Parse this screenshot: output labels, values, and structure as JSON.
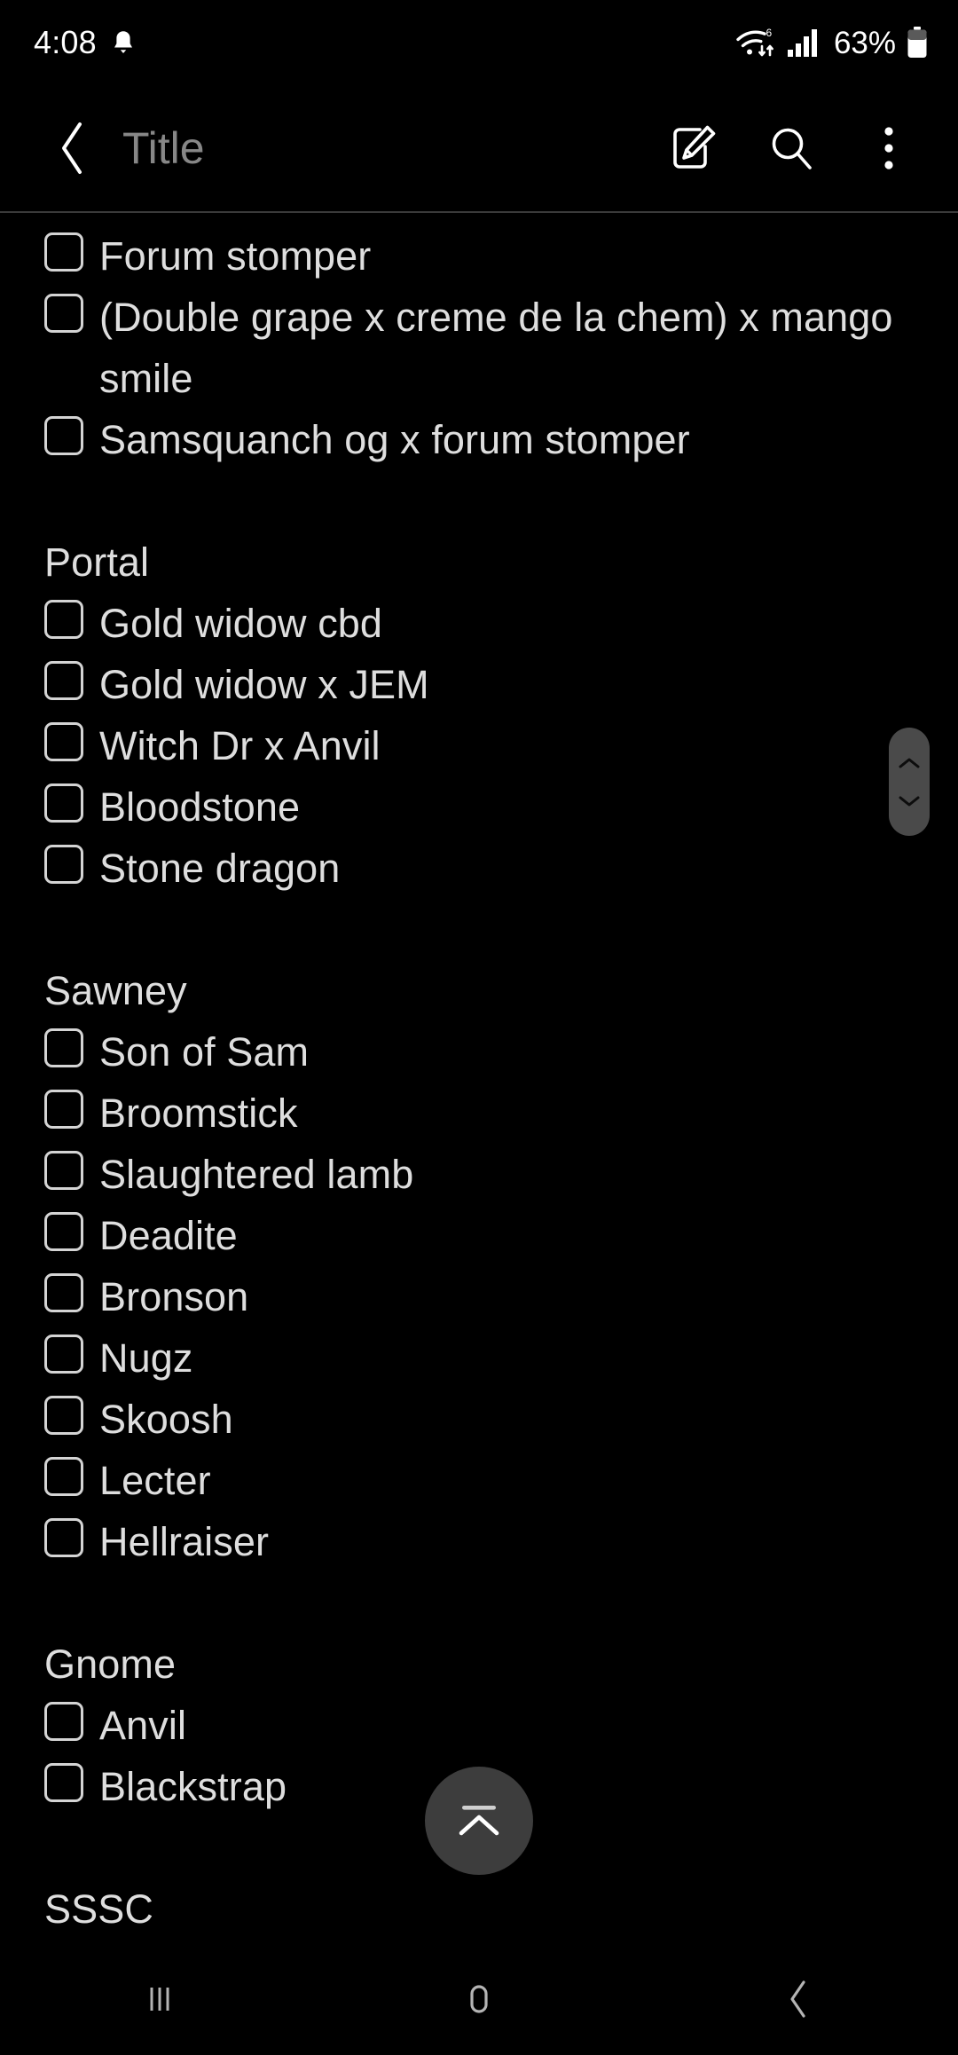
{
  "status_bar": {
    "time": "4:08",
    "battery_percent": "63%",
    "icons": {
      "notification": "bell-icon",
      "wifi": "wifi-6-icon",
      "signal": "cellular-signal-icon",
      "battery": "battery-icon"
    }
  },
  "app_bar": {
    "back": "back-chevron-icon",
    "title_placeholder": "Title",
    "actions": [
      {
        "name": "compose-icon",
        "label": "Compose"
      },
      {
        "name": "search-icon",
        "label": "Search"
      },
      {
        "name": "overflow-menu-icon",
        "label": "More options"
      }
    ]
  },
  "note": {
    "blocks": [
      {
        "type": "checkbox",
        "text": "Forum stomper",
        "checked": false
      },
      {
        "type": "checkbox",
        "text": "(Double grape x creme de la chem) x mango smile",
        "checked": false
      },
      {
        "type": "checkbox",
        "text": "Samsquanch og x forum stomper",
        "checked": false
      },
      {
        "type": "blank",
        "text": ""
      },
      {
        "type": "heading",
        "text": "Portal"
      },
      {
        "type": "checkbox",
        "text": "Gold widow cbd",
        "checked": false
      },
      {
        "type": "checkbox",
        "text": "Gold widow x JEM",
        "checked": false
      },
      {
        "type": "checkbox",
        "text": "Witch Dr x Anvil",
        "checked": false
      },
      {
        "type": "checkbox",
        "text": "Bloodstone",
        "checked": false
      },
      {
        "type": "checkbox",
        "text": "Stone dragon",
        "checked": false
      },
      {
        "type": "blank",
        "text": ""
      },
      {
        "type": "heading",
        "text": "Sawney"
      },
      {
        "type": "checkbox",
        "text": "Son of Sam",
        "checked": false
      },
      {
        "type": "checkbox",
        "text": "Broomstick",
        "checked": false
      },
      {
        "type": "checkbox",
        "text": "Slaughtered lamb",
        "checked": false
      },
      {
        "type": "checkbox",
        "text": "Deadite",
        "checked": false
      },
      {
        "type": "checkbox",
        "text": "Bronson",
        "checked": false
      },
      {
        "type": "checkbox",
        "text": "Nugz",
        "checked": false
      },
      {
        "type": "checkbox",
        "text": "Skoosh",
        "checked": false
      },
      {
        "type": "checkbox",
        "text": "Lecter",
        "checked": false
      },
      {
        "type": "checkbox",
        "text": "Hellraiser",
        "checked": false
      },
      {
        "type": "blank",
        "text": ""
      },
      {
        "type": "heading",
        "text": "Gnome"
      },
      {
        "type": "checkbox",
        "text": "Anvil",
        "checked": false
      },
      {
        "type": "checkbox",
        "text": "Blackstrap",
        "checked": false
      },
      {
        "type": "blank",
        "text": ""
      },
      {
        "type": "heading",
        "text": "SSSC"
      }
    ]
  },
  "scrollbar": {
    "name": "scrollbar-thumb",
    "up": "chevron-up-icon",
    "down": "chevron-down-icon"
  },
  "fab": {
    "name": "scroll-to-top-button",
    "icon": "collapse-up-icon"
  },
  "nav_bar": {
    "items": [
      {
        "name": "recents-button",
        "icon": "recents-icon"
      },
      {
        "name": "home-button",
        "icon": "home-icon"
      },
      {
        "name": "back-button",
        "icon": "back-icon"
      }
    ]
  },
  "colors": {
    "background": "#000000",
    "text": "#dedede",
    "title_placeholder": "#878787",
    "divider": "#3a3a3a",
    "fab_bg": "#3d3d3d",
    "scrollbar_bg": "#4a4a4a",
    "icon": "#ffffff",
    "nav_icon": "#b4b4b4"
  }
}
